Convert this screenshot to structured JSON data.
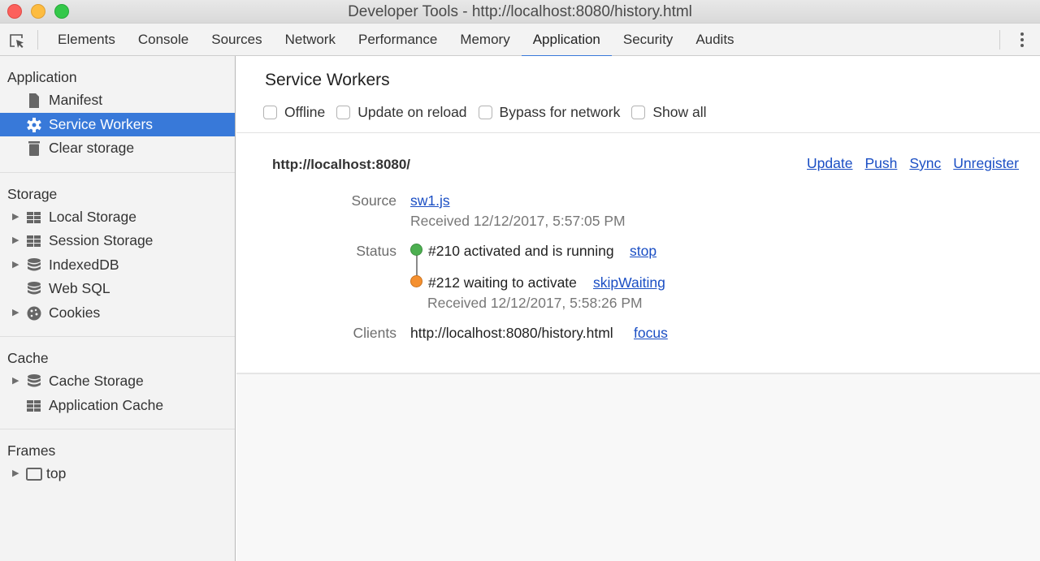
{
  "window": {
    "title": "Developer Tools - http://localhost:8080/history.html"
  },
  "toolbar": {
    "inspect_icon": "inspect-element-icon",
    "more_icon": "vertical-ellipsis-icon",
    "tabs": [
      {
        "label": "Elements",
        "active": false
      },
      {
        "label": "Console",
        "active": false
      },
      {
        "label": "Sources",
        "active": false
      },
      {
        "label": "Network",
        "active": false
      },
      {
        "label": "Performance",
        "active": false
      },
      {
        "label": "Memory",
        "active": false
      },
      {
        "label": "Application",
        "active": true
      },
      {
        "label": "Security",
        "active": false
      },
      {
        "label": "Audits",
        "active": false
      }
    ],
    "accent_color": "#3879d9"
  },
  "sidebar": {
    "sections": [
      {
        "title": "Application",
        "items": [
          {
            "label": "Manifest",
            "icon": "document-icon",
            "expandable": false,
            "selected": false
          },
          {
            "label": "Service Workers",
            "icon": "gear-icon",
            "expandable": false,
            "selected": true
          },
          {
            "label": "Clear storage",
            "icon": "trash-icon",
            "expandable": false,
            "selected": false
          }
        ]
      },
      {
        "title": "Storage",
        "items": [
          {
            "label": "Local Storage",
            "icon": "grid-icon",
            "expandable": true
          },
          {
            "label": "Session Storage",
            "icon": "grid-icon",
            "expandable": true
          },
          {
            "label": "IndexedDB",
            "icon": "database-icon",
            "expandable": true
          },
          {
            "label": "Web SQL",
            "icon": "database-icon",
            "expandable": false
          },
          {
            "label": "Cookies",
            "icon": "cookie-icon",
            "expandable": true
          }
        ]
      },
      {
        "title": "Cache",
        "items": [
          {
            "label": "Cache Storage",
            "icon": "database-icon",
            "expandable": true
          },
          {
            "label": "Application Cache",
            "icon": "grid-icon",
            "expandable": false
          }
        ]
      },
      {
        "title": "Frames",
        "items": [
          {
            "label": "top",
            "icon": "frame-icon",
            "expandable": true
          }
        ]
      }
    ]
  },
  "main": {
    "title": "Service Workers",
    "options": [
      {
        "label": "Offline",
        "checked": false
      },
      {
        "label": "Update on reload",
        "checked": false
      },
      {
        "label": "Bypass for network",
        "checked": false
      },
      {
        "label": "Show all",
        "checked": false
      }
    ],
    "worker": {
      "origin": "http://localhost:8080/",
      "actions": [
        "Update",
        "Push",
        "Sync",
        "Unregister"
      ],
      "source_label": "Source",
      "source_file": "sw1.js",
      "source_received": "Received 12/12/2017, 5:57:05 PM",
      "status_label": "Status",
      "statuses": [
        {
          "text": "#210 activated and is running",
          "action": "stop",
          "color": "#4caf50"
        },
        {
          "text": "#212 waiting to activate",
          "action": "skipWaiting",
          "color": "#f5902f",
          "received": "Received 12/12/2017, 5:58:26 PM"
        }
      ],
      "clients_label": "Clients",
      "client_url": "http://localhost:8080/history.html",
      "client_action": "focus"
    }
  }
}
